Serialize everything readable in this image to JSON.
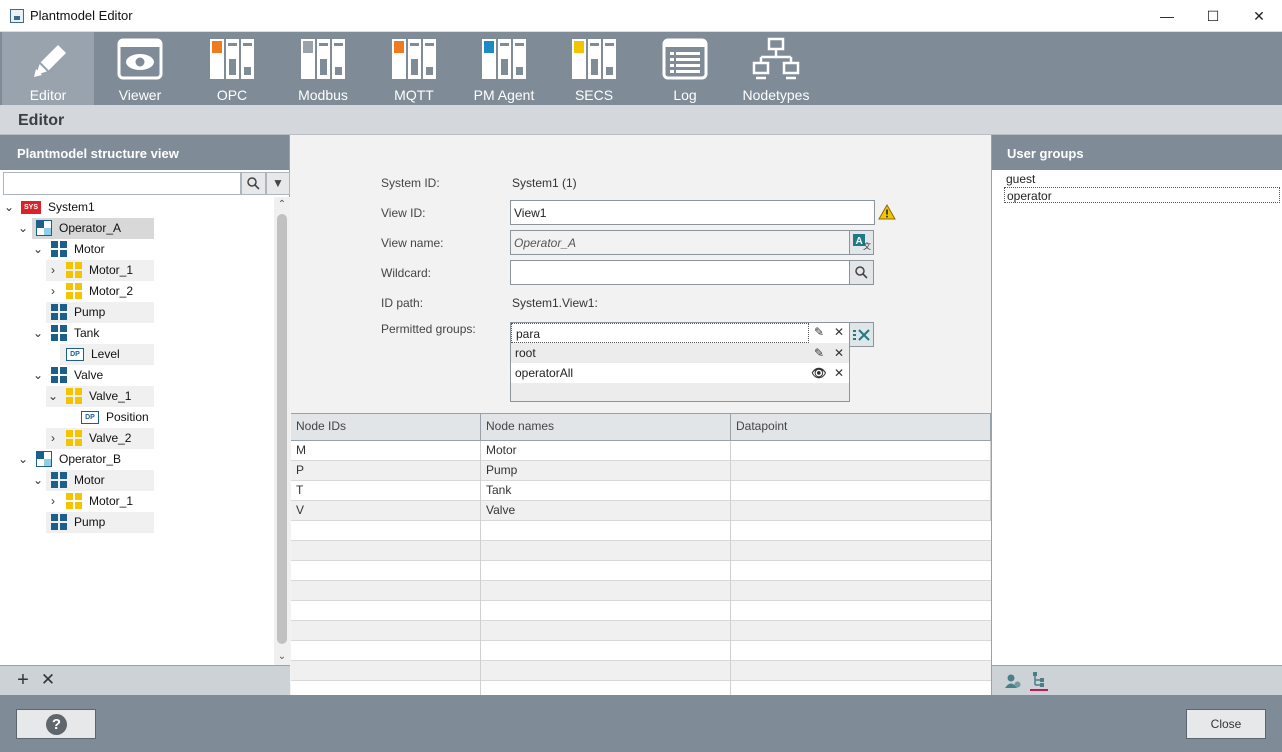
{
  "window": {
    "title": "Plantmodel Editor"
  },
  "toolbar": {
    "items": [
      {
        "label": "Editor",
        "icon": "pencil-icon"
      },
      {
        "label": "Viewer",
        "icon": "eye-window-icon"
      },
      {
        "label": "OPC",
        "icon": "module-orange-icon"
      },
      {
        "label": "Modbus",
        "icon": "module-gray-icon"
      },
      {
        "label": "MQTT",
        "icon": "module-orange-icon"
      },
      {
        "label": "PM Agent",
        "icon": "module-blue-icon"
      },
      {
        "label": "SECS",
        "icon": "module-yellow-icon"
      },
      {
        "label": "Log",
        "icon": "log-list-icon"
      },
      {
        "label": "Nodetypes",
        "icon": "network-tree-icon"
      }
    ]
  },
  "section": {
    "title": "Editor"
  },
  "left": {
    "header": "Plantmodel structure view",
    "search_value": "",
    "tree": [
      {
        "label": "System1"
      },
      {
        "label": "Operator_A"
      },
      {
        "label": "Motor"
      },
      {
        "label": "Motor_1"
      },
      {
        "label": "Motor_2"
      },
      {
        "label": "Pump"
      },
      {
        "label": "Tank"
      },
      {
        "label": "Level",
        "badge": "DP"
      },
      {
        "label": "Valve"
      },
      {
        "label": "Valve_1"
      },
      {
        "label": "Position",
        "badge": "DP"
      },
      {
        "label": "Valve_2"
      },
      {
        "label": "Operator_B"
      },
      {
        "label": "Motor"
      },
      {
        "label": "Motor_1"
      },
      {
        "label": "Pump"
      }
    ],
    "sys_badge": "SYS"
  },
  "form": {
    "system_id_label": "System ID:",
    "system_id_value": "System1 (1)",
    "view_id_label": "View ID:",
    "view_id_value": "View1",
    "view_name_label": "View name:",
    "view_name_value": "Operator_A",
    "wildcard_label": "Wildcard:",
    "wildcard_value": "",
    "id_path_label": "ID path:",
    "id_path_value": "System1.View1:",
    "permitted_groups_label": "Permitted groups:",
    "groups": [
      {
        "name": "para"
      },
      {
        "name": "root"
      },
      {
        "name": "operatorAll"
      }
    ]
  },
  "table": {
    "headers": [
      "Node IDs",
      "Node names",
      "Datapoint"
    ],
    "rows": [
      [
        "M",
        "Motor",
        ""
      ],
      [
        "P",
        "Pump",
        ""
      ],
      [
        "T",
        "Tank",
        ""
      ],
      [
        "V",
        "Valve",
        ""
      ]
    ]
  },
  "right": {
    "header": "User groups",
    "groups": [
      "guest",
      "operator"
    ]
  },
  "footer": {
    "close_label": "Close",
    "help_label": "?"
  },
  "colors": {
    "toolbar": "#7f8b96",
    "accent_orange": "#f07a1e",
    "accent_blue": "#1b8ac6",
    "accent_yellow": "#f5c400",
    "sys_red": "#d8232a"
  }
}
